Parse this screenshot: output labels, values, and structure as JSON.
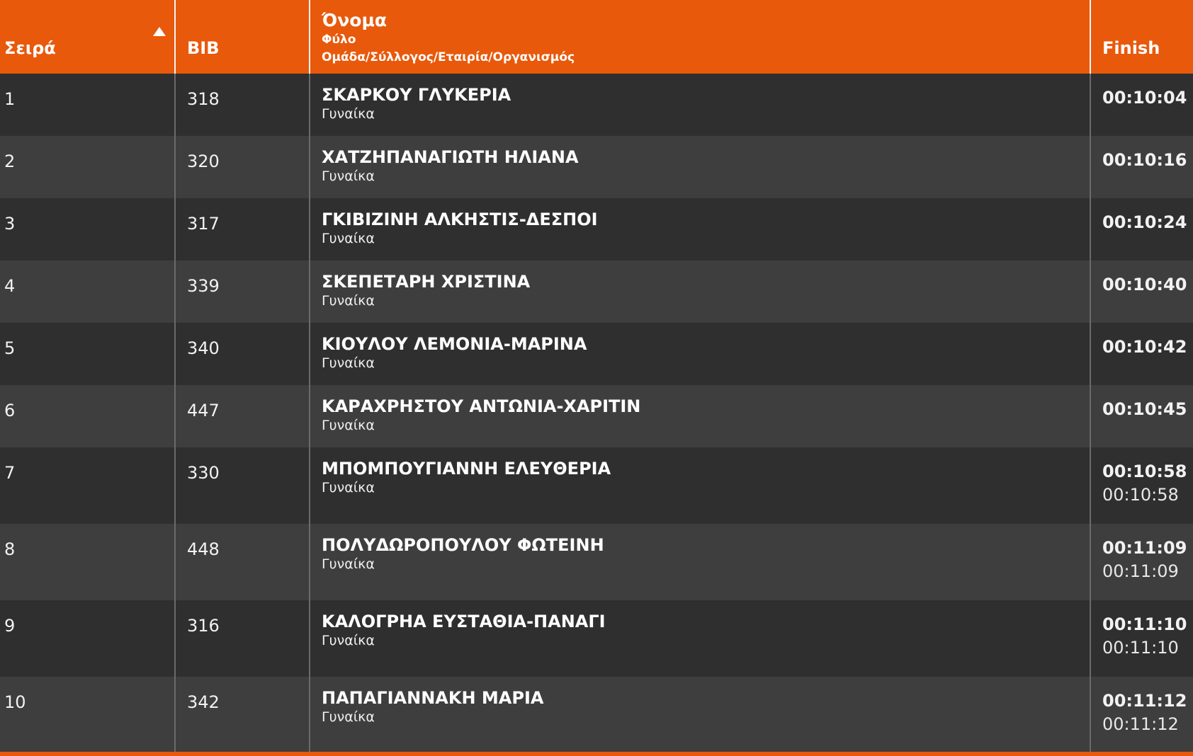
{
  "headers": {
    "rank": "Σειρά",
    "bib": "BIB",
    "name": "Όνομα",
    "gender": "Φύλο",
    "team": "Ομάδα/Σύλλογος/Εταιρία/Οργανισμός",
    "finish": "Finish"
  },
  "sort": {
    "column": "rank",
    "direction": "ascending",
    "icon": "sort-asc-icon"
  },
  "colors": {
    "accent": "#e8590c",
    "row_dark": "#2f2f2f",
    "row_light": "#3e3e3e"
  },
  "rows": [
    {
      "rank": "1",
      "bib": "318",
      "name": "ΣΚΑΡΚΟΥ ΓΛΥΚΕΡΙΑ",
      "gender": "Γυναίκα",
      "finish": "00:10:04",
      "finish2": ""
    },
    {
      "rank": "2",
      "bib": "320",
      "name": "ΧΑΤΖΗΠΑΝΑΓΙΩΤΗ ΗΛΙΑΝΑ",
      "gender": "Γυναίκα",
      "finish": "00:10:16",
      "finish2": ""
    },
    {
      "rank": "3",
      "bib": "317",
      "name": "ΓΚΙΒΙΖΙΝΗ ΑΛΚΗΣΤΙΣ-ΔΕΣΠΟΙ",
      "gender": "Γυναίκα",
      "finish": "00:10:24",
      "finish2": ""
    },
    {
      "rank": "4",
      "bib": "339",
      "name": "ΣΚΕΠΕΤΑΡΗ ΧΡΙΣΤΙΝΑ",
      "gender": "Γυναίκα",
      "finish": "00:10:40",
      "finish2": ""
    },
    {
      "rank": "5",
      "bib": "340",
      "name": "ΚΙΟΥΛΟΥ ΛΕΜΟΝΙΑ-ΜΑΡΙΝΑ",
      "gender": "Γυναίκα",
      "finish": "00:10:42",
      "finish2": ""
    },
    {
      "rank": "6",
      "bib": "447",
      "name": "ΚΑΡΑΧΡΗΣΤΟΥ ΑΝΤΩΝΙΑ-ΧΑΡΙΤΙΝ",
      "gender": "Γυναίκα",
      "finish": "00:10:45",
      "finish2": ""
    },
    {
      "rank": "7",
      "bib": "330",
      "name": "ΜΠΟΜΠΟΥΓΙΑΝΝΗ ΕΛΕΥΘΕΡΙΑ",
      "gender": "Γυναίκα",
      "finish": "00:10:58",
      "finish2": "00:10:58"
    },
    {
      "rank": "8",
      "bib": "448",
      "name": "ΠΟΛΥΔΩΡΟΠΟΥΛΟΥ ΦΩΤΕΙΝΗ",
      "gender": "Γυναίκα",
      "finish": "00:11:09",
      "finish2": "00:11:09"
    },
    {
      "rank": "9",
      "bib": "316",
      "name": "ΚΑΛΟΓΡΗΑ ΕΥΣΤΑΘΙΑ-ΠΑΝΑΓΙ",
      "gender": "Γυναίκα",
      "finish": "00:11:10",
      "finish2": "00:11:10"
    },
    {
      "rank": "10",
      "bib": "342",
      "name": "ΠΑΠΑΓΙΑΝΝΑΚΗ ΜΑΡΙΑ",
      "gender": "Γυναίκα",
      "finish": "00:11:12",
      "finish2": "00:11:12"
    }
  ]
}
